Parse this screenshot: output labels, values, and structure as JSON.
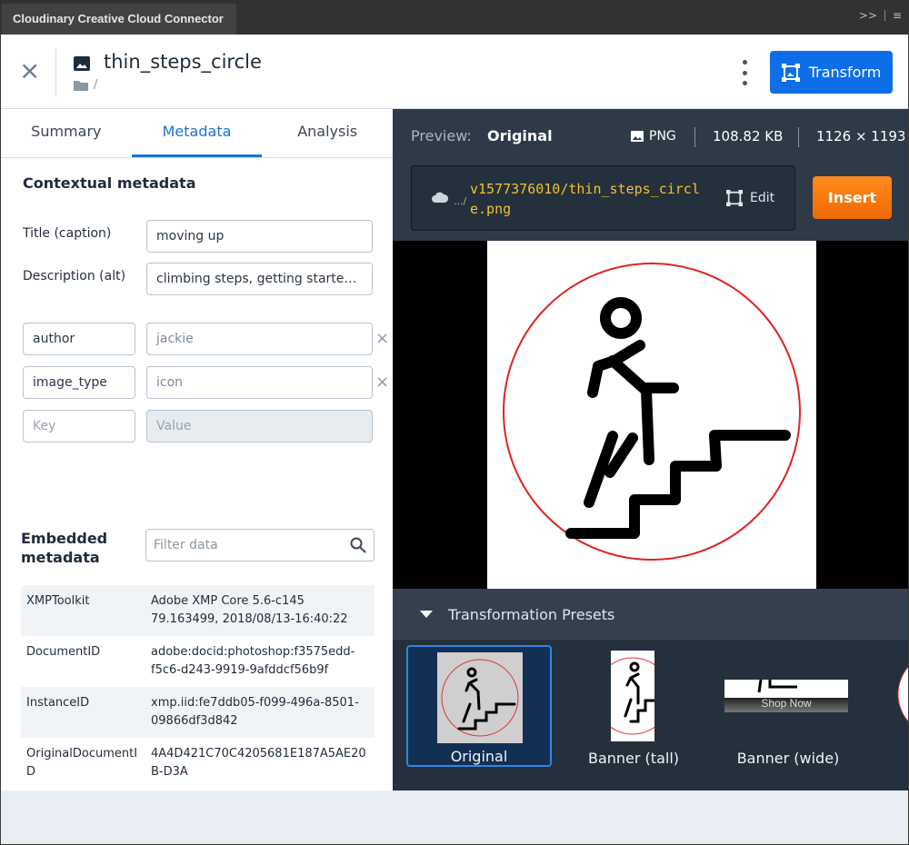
{
  "panel": {
    "title": "Cloudinary Creative Cloud Connector",
    "controls": ">>"
  },
  "header": {
    "asset_name": "thin_steps_circle",
    "folder_path": "/",
    "transform_label": "Transform"
  },
  "tabs": [
    {
      "label": "Summary"
    },
    {
      "label": "Metadata"
    },
    {
      "label": "Analysis"
    }
  ],
  "contextual": {
    "title": "Contextual metadata",
    "fields": [
      {
        "label": "Title (caption)",
        "value": "moving up"
      },
      {
        "label": "Description (alt)",
        "value": "climbing steps, getting started, i..."
      }
    ],
    "custom": [
      {
        "key": "author",
        "value": "jackie"
      },
      {
        "key": "image_type",
        "value": "icon"
      }
    ],
    "key_placeholder": "Key",
    "value_placeholder": "Value"
  },
  "embedded": {
    "title_line1": "Embedded",
    "title_line2": "metadata",
    "filter_placeholder": "Filter data",
    "rows": [
      {
        "key": "XMPToolkit",
        "value": "Adobe XMP Core 5.6-c145 79.163499, 2018/08/13-16:40:22"
      },
      {
        "key": "DocumentID",
        "value": "adobe:docid:photoshop:f3575edd-f5c6-d243-9919-9afddcf56b9f"
      },
      {
        "key": "InstanceID",
        "value": "xmp.iid:fe7ddb05-f099-496a-8501-09866df3d842"
      },
      {
        "key": "OriginalDocumentID",
        "value": "4A4D421C70C4205681E187A5AE20B-D3A"
      }
    ]
  },
  "preview": {
    "label": "Preview:",
    "mode": "Original",
    "format": "PNG",
    "size": "108.82 KB",
    "dimensions": "1126 × 1193",
    "url_prefix": ".../",
    "url": "v1577376010/thin_steps_circle.png",
    "edit_label": "Edit",
    "insert_label": "Insert"
  },
  "presets": {
    "title": "Transformation Presets",
    "items": [
      {
        "name": "Original",
        "selected": true
      },
      {
        "name": "Banner (tall)",
        "selected": false
      },
      {
        "name": "Banner (wide)",
        "selected": false
      }
    ],
    "banner_text": "Shop Now"
  },
  "colors": {
    "accent": "#0d6ee8",
    "insert": "#f47a0f",
    "url": "#f2c12e",
    "circle": "#e22222",
    "dark_pane": "#2e3a48"
  }
}
